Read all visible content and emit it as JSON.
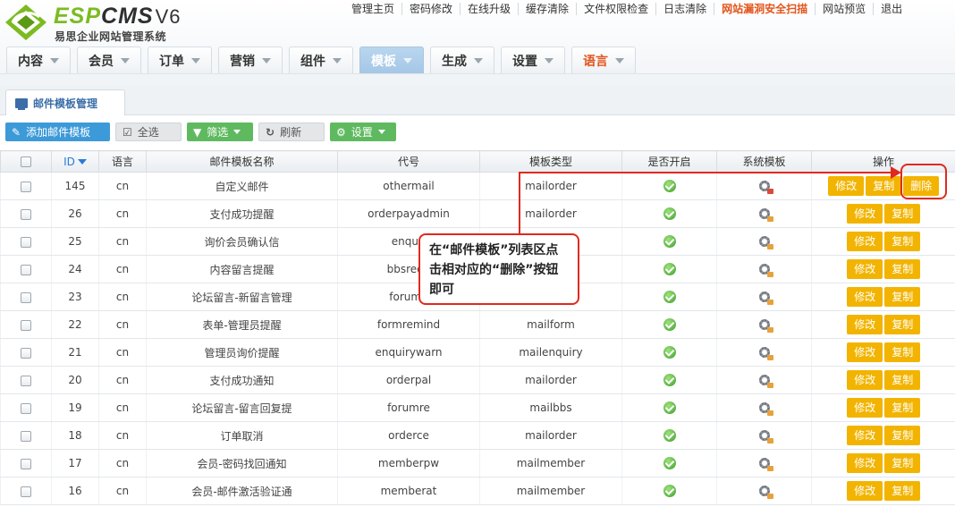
{
  "brand": {
    "logo_prefix": "ESP",
    "logo_mid": "CMS",
    "logo_version": "V6",
    "subtitle": "易思企业网站管理系统"
  },
  "toplinks": [
    "管理主页",
    "密码修改",
    "在线升级",
    "缓存清除",
    "文件权限检查",
    "日志清除",
    "网站漏洞安全扫描",
    "网站预览",
    "退出"
  ],
  "nav": {
    "tabs": [
      {
        "label": "内容"
      },
      {
        "label": "会员"
      },
      {
        "label": "订单"
      },
      {
        "label": "营销"
      },
      {
        "label": "组件"
      },
      {
        "label": "模板"
      },
      {
        "label": "生成"
      },
      {
        "label": "设置"
      },
      {
        "label": "语言"
      }
    ]
  },
  "page_tab": {
    "label": "邮件模板管理"
  },
  "toolbar": {
    "add": "添加邮件模板",
    "select_all": "全选",
    "filter": "筛选",
    "refresh": "刷新",
    "settings": "设置"
  },
  "table": {
    "headers": {
      "id": "ID",
      "lang": "语言",
      "name": "邮件模板名称",
      "code": "代号",
      "type": "模板类型",
      "enabled": "是否开启",
      "system": "系统模板",
      "actions": "操作"
    },
    "action_labels": {
      "edit": "修改",
      "copy": "复制",
      "delete": "删除"
    },
    "rows": [
      {
        "id": "145",
        "lang": "cn",
        "name": "自定义邮件",
        "code": "othermail",
        "type": "mailorder",
        "deletable": true
      },
      {
        "id": "26",
        "lang": "cn",
        "name": "支付成功提醒",
        "code": "orderpayadmin",
        "type": "mailorder"
      },
      {
        "id": "25",
        "lang": "cn",
        "name": "询价会员确认信",
        "code": "enquir",
        "type": ""
      },
      {
        "id": "24",
        "lang": "cn",
        "name": "内容留言提醒",
        "code": "bbsrequ",
        "type": ""
      },
      {
        "id": "23",
        "lang": "cn",
        "name": "论坛留言-新留言管理",
        "code": "forumn",
        "type": ""
      },
      {
        "id": "22",
        "lang": "cn",
        "name": "表单-管理员提醒",
        "code": "formremind",
        "type": "mailform"
      },
      {
        "id": "21",
        "lang": "cn",
        "name": "管理员询价提醒",
        "code": "enquirywarn",
        "type": "mailenquiry"
      },
      {
        "id": "20",
        "lang": "cn",
        "name": "支付成功通知",
        "code": "orderpal",
        "type": "mailorder"
      },
      {
        "id": "19",
        "lang": "cn",
        "name": "论坛留言-留言回复提",
        "code": "forumre",
        "type": "mailbbs"
      },
      {
        "id": "18",
        "lang": "cn",
        "name": "订单取消",
        "code": "orderce",
        "type": "mailorder"
      },
      {
        "id": "17",
        "lang": "cn",
        "name": "会员-密码找回通知",
        "code": "memberpw",
        "type": "mailmember"
      },
      {
        "id": "16",
        "lang": "cn",
        "name": "会员-邮件激活验证通",
        "code": "memberat",
        "type": "mailmember"
      }
    ]
  },
  "callout": {
    "text": "在“邮件模板”列表区点击相对应的“删除”按钮即可"
  }
}
